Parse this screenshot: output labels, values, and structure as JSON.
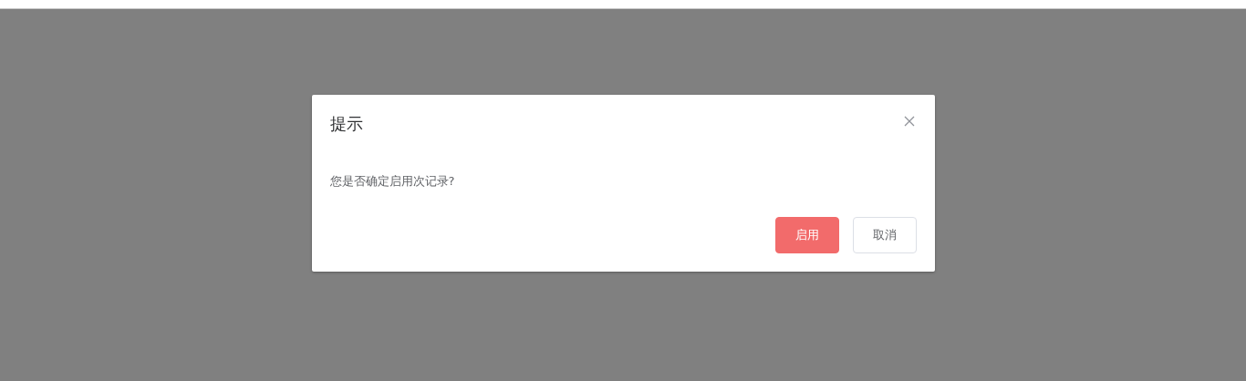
{
  "dialog": {
    "title": "提示",
    "message": "您是否确定启用次记录?",
    "buttons": [
      {
        "label": "启用",
        "kind": "primary"
      },
      {
        "label": "取消",
        "kind": "default"
      }
    ]
  }
}
